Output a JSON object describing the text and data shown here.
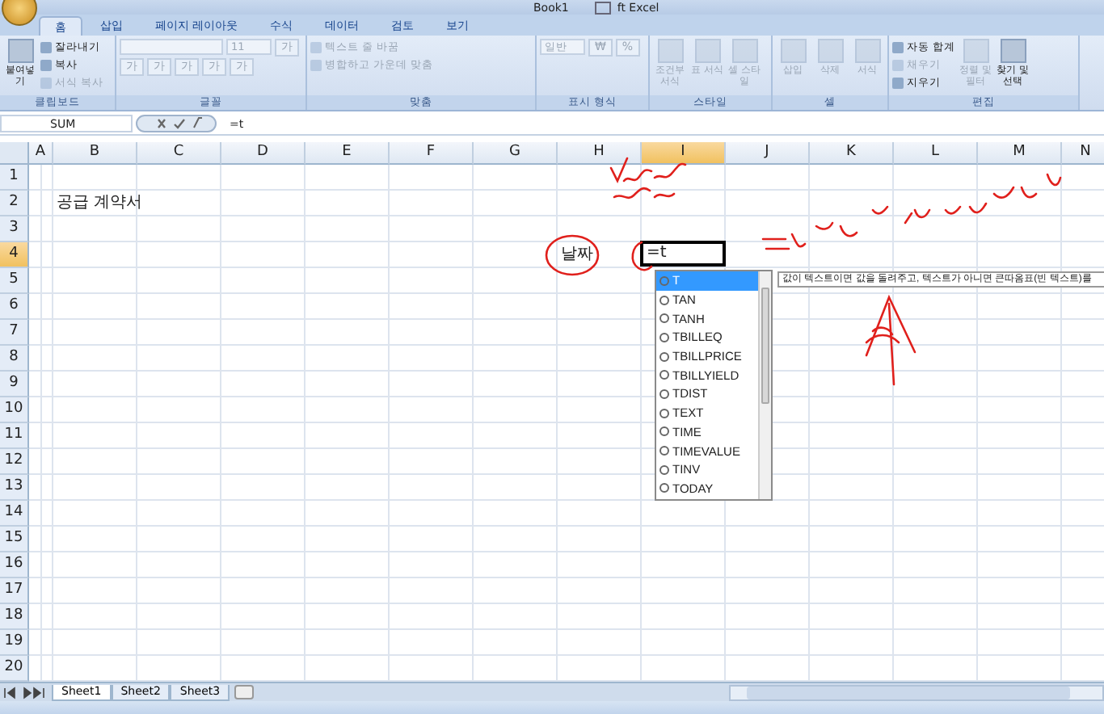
{
  "title_bar": {
    "document": "Book1",
    "app": "ft Excel"
  },
  "ribbon_tabs": [
    {
      "label": "홈",
      "selected": true
    },
    {
      "label": "삽입",
      "selected": false
    },
    {
      "label": "페이지 레이아웃",
      "selected": false
    },
    {
      "label": "수식",
      "selected": false
    },
    {
      "label": "데이터",
      "selected": false
    },
    {
      "label": "검토",
      "selected": false
    },
    {
      "label": "보기",
      "selected": false
    }
  ],
  "ribbon_groups": [
    {
      "label": "클립보드",
      "items": [
        {
          "kind": "large",
          "label": "붙여넣기",
          "disabled": false
        },
        {
          "kind": "small",
          "label": "잘라내기",
          "disabled": false
        },
        {
          "kind": "small",
          "label": "복사",
          "disabled": false
        },
        {
          "kind": "small",
          "label": "서식 복사",
          "disabled": true
        }
      ]
    },
    {
      "label": "글꼴",
      "items": [
        {
          "kind": "field",
          "disabled": true
        },
        {
          "kind": "field",
          "label": "11",
          "disabled": true
        },
        {
          "kind": "glyph",
          "label": "가",
          "disabled": true
        },
        {
          "kind": "glyph",
          "label": "가",
          "disabled": true
        },
        {
          "kind": "glyph",
          "label": "가",
          "disabled": true
        },
        {
          "kind": "glyph",
          "label": "가",
          "disabled": true
        },
        {
          "kind": "glyph",
          "label": "가",
          "disabled": true
        },
        {
          "kind": "glyph",
          "label": "가",
          "disabled": true
        }
      ]
    },
    {
      "label": "맞춤",
      "items": [
        {
          "kind": "small",
          "label": "텍스트 줄 바꿈",
          "disabled": true
        },
        {
          "kind": "small",
          "label": "병합하고 가운데 맞춤",
          "disabled": true
        }
      ]
    },
    {
      "label": "표시 형식",
      "items": [
        {
          "kind": "field",
          "label": "일반",
          "disabled": true
        },
        {
          "kind": "glyph",
          "label": "₩",
          "disabled": true
        },
        {
          "kind": "glyph",
          "label": "%",
          "disabled": true
        }
      ]
    },
    {
      "label": "스타일",
      "items": [
        {
          "kind": "large",
          "label": "조건부 서식",
          "disabled": true
        },
        {
          "kind": "large",
          "label": "표 서식",
          "disabled": true
        },
        {
          "kind": "large",
          "label": "셀 스타일",
          "disabled": true
        }
      ]
    },
    {
      "label": "셀",
      "items": [
        {
          "kind": "large",
          "label": "삽입",
          "disabled": true
        },
        {
          "kind": "large",
          "label": "삭제",
          "disabled": true
        },
        {
          "kind": "large",
          "label": "서식",
          "disabled": true
        }
      ]
    },
    {
      "label": "편집",
      "items": [
        {
          "kind": "small",
          "label": "자동 합계",
          "disabled": false
        },
        {
          "kind": "small",
          "label": "채우기",
          "disabled": true
        },
        {
          "kind": "small",
          "label": "지우기",
          "disabled": false
        },
        {
          "kind": "large",
          "label": "정렬 및 필터",
          "disabled": true
        },
        {
          "kind": "large",
          "label": "찾기 및 선택",
          "disabled": false
        }
      ]
    }
  ],
  "formula_bar": {
    "name_box": "SUM",
    "formula": "=t"
  },
  "columns": [
    {
      "label": "A",
      "selected": false
    },
    {
      "label": "B",
      "selected": false
    },
    {
      "label": "C",
      "selected": false
    },
    {
      "label": "D",
      "selected": false
    },
    {
      "label": "E",
      "selected": false
    },
    {
      "label": "F",
      "selected": false
    },
    {
      "label": "G",
      "selected": false
    },
    {
      "label": "H",
      "selected": false
    },
    {
      "label": "I",
      "selected": true
    },
    {
      "label": "J",
      "selected": false
    },
    {
      "label": "K",
      "selected": false
    },
    {
      "label": "L",
      "selected": false
    },
    {
      "label": "M",
      "selected": false
    },
    {
      "label": "N",
      "selected": false
    }
  ],
  "rows": [
    {
      "label": "1",
      "selected": false
    },
    {
      "label": "2",
      "selected": false,
      "cells": {
        "B": "공급 계약서"
      }
    },
    {
      "label": "3",
      "selected": false
    },
    {
      "label": "4",
      "selected": true,
      "cells": {
        "H": "날짜",
        "I": "=t"
      }
    },
    {
      "label": "5",
      "selected": false
    },
    {
      "label": "6",
      "selected": false
    },
    {
      "label": "7",
      "selected": false
    },
    {
      "label": "8",
      "selected": false
    },
    {
      "label": "9",
      "selected": false
    },
    {
      "label": "10",
      "selected": false
    },
    {
      "label": "11",
      "selected": false
    },
    {
      "label": "12",
      "selected": false
    },
    {
      "label": "13",
      "selected": false
    },
    {
      "label": "14",
      "selected": false
    },
    {
      "label": "15",
      "selected": false
    },
    {
      "label": "16",
      "selected": false
    },
    {
      "label": "17",
      "selected": false
    },
    {
      "label": "18",
      "selected": false
    },
    {
      "label": "19",
      "selected": false
    },
    {
      "label": "20",
      "selected": false
    }
  ],
  "autocomplete": [
    {
      "label": "T",
      "selected": true
    },
    {
      "label": "TAN",
      "selected": false
    },
    {
      "label": "TANH",
      "selected": false
    },
    {
      "label": "TBILLEQ",
      "selected": false
    },
    {
      "label": "TBILLPRICE",
      "selected": false
    },
    {
      "label": "TBILLYIELD",
      "selected": false
    },
    {
      "label": "TDIST",
      "selected": false
    },
    {
      "label": "TEXT",
      "selected": false
    },
    {
      "label": "TIME",
      "selected": false
    },
    {
      "label": "TIMEVALUE",
      "selected": false
    },
    {
      "label": "TINV",
      "selected": false
    },
    {
      "label": "TODAY",
      "selected": false
    }
  ],
  "tooltip": "값이 텍스트이면 값을 돌려주고, 텍스트가 아니면 큰따옴표(빈 텍스트)를",
  "sheet_tabs": [
    {
      "label": "Sheet1",
      "selected": true
    },
    {
      "label": "Sheet2",
      "selected": false
    },
    {
      "label": "Sheet3",
      "selected": false
    }
  ]
}
